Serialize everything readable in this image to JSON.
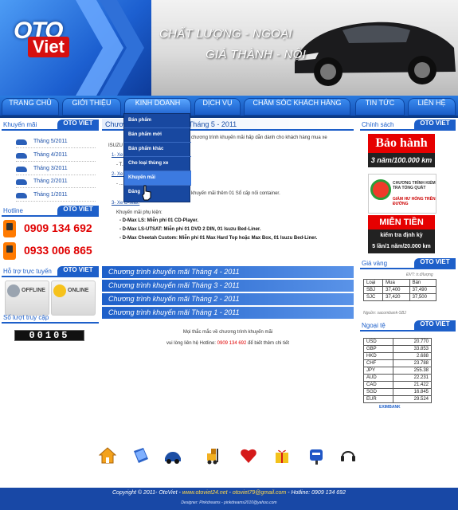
{
  "header": {
    "logo_oto": "OTO",
    "logo_viet": "Viet",
    "slogan_line1": "CHẤT LƯỢNG - NGOẠI",
    "slogan_line2": "GIÁ THÀNH - NỘI"
  },
  "nav": {
    "items": [
      "TRANG CHỦ",
      "GIỚI THIỆU",
      "KINH DOANH",
      "DỊCH VỤ",
      "CHĂM SÓC KHÁCH HÀNG",
      "TIN TỨC",
      "LIÊN HỆ"
    ],
    "active_index": 2
  },
  "dropdown": {
    "items": [
      "Bán phẩm",
      "Bán phẩm mới",
      "Bán phẩm khác",
      "Cho loại thùng xe",
      "Khuyến mãi",
      "Đăng"
    ],
    "hover_index": 4
  },
  "left": {
    "promo_title": "Khuyến mãi",
    "tag": "OTO VIET",
    "promo_items": [
      "Tháng 5/2011",
      "Tháng 4/2011",
      "Tháng 3/2011",
      "Tháng 2/2011",
      "Tháng 1/2011"
    ],
    "hotline_title": "Hotline",
    "hotline_numbers": [
      "0909 134 692",
      "0933 006 865"
    ],
    "support_title": "Hỗ trợ trực tuyến",
    "support_offline": "OFFLINE",
    "support_online": "ONLINE",
    "visits_title": "Số lượt truy cập",
    "visits_count": "00105"
  },
  "main": {
    "title": "Chương trình khuyến mãi Tháng 5 - 2011",
    "lines": [
      "chương trình khuyến mãi hấp dẫn dành cho khách hàng mua xe",
      "ISUZU tháng 5 năm 2011:",
      "1- Xe ...",
      "- T... layer",
      "2- Xe ...",
      "- ...",
      "khuyến mãi thêm 01 Sổ cấp nối container.",
      "3- Xe D-Max:",
      "Khuyến mãi phụ kiện:",
      "- D-Max LS: Miễn phí 01 CD-Player.",
      "- D-Max LS-UTSAT: Miễn phí 01 DVD 2 DIN, 01 Isuzu Bed-Liner.",
      "- D-Max Cheetah Custom: Miễn phí 01 Max Hard Top hoặc Max Box, 01 Isuzu Bed-Liner."
    ],
    "month_bars": [
      "Chương trình khuyến mãi Tháng 4 - 2011",
      "Chương trình khuyến mãi Tháng 3 - 2011",
      "Chương trình khuyến mãi Tháng 2 - 2011",
      "Chương trình khuyến mãi Tháng 1 - 2011"
    ],
    "note_line1": "Mọi thắc mắc về chương trình khuyến mãi",
    "note_line2_prefix": "vui lòng liên hệ Hotline: ",
    "note_hotline": "0909 134 692",
    "note_line2_suffix": " để biết thêm chi tiết"
  },
  "right": {
    "policy_title": "Chính sách",
    "tag": "OTO VIET",
    "warranty_top": "Bảo hành",
    "warranty_bottom": "3 năm/100.000 km",
    "check_line1": "CHƯƠNG TRÌNH KIỂM TRA TỔNG QUÁT",
    "check_line2": "GIẢM HƯ HỎNG TRÊN ĐƯỜNG",
    "free_title": "MIỄN TIỀN CÔNG",
    "free_sub1": "kiểm tra định kỳ",
    "free_sub2": "5 lần/1 năm/20.000 km",
    "gold_title": "Giá vàng",
    "gold_note": "ĐVT: tr.đ/lượng",
    "gold_headers": [
      "Loại",
      "Mua",
      "Bán"
    ],
    "gold_rows": [
      [
        "SBJ",
        "37,400",
        "37,490"
      ],
      [
        "SJC",
        "37,420",
        "37,500"
      ]
    ],
    "gold_source": "Nguồn: sacombank-SBJ",
    "fx_title": "Ngoại tệ",
    "fx_rows": [
      [
        "USD",
        "20.770"
      ],
      [
        "GBP",
        "33.853"
      ],
      [
        "HKD",
        "2.688"
      ],
      [
        "CHF",
        "23.788"
      ],
      [
        "JPY",
        "255.38"
      ],
      [
        "AUD",
        "22.231"
      ],
      [
        "CAD",
        "21.422"
      ],
      [
        "SGD",
        "16.845"
      ],
      [
        "EUR",
        "29.524"
      ]
    ],
    "fx_source": "EXIMBANK"
  },
  "footer_icons": [
    "home-icon",
    "book-icon",
    "car-icon",
    "forklift-icon",
    "heart-icon",
    "promotion-icon",
    "mailbox-icon",
    "support-headset-icon"
  ],
  "footer": {
    "copyright_prefix": "Copyright © 2011- OtoViet - ",
    "website": "www.otoviet24.net",
    "sep1": " - ",
    "email": "otoviet79@gmail.com",
    "hotline_text": " - Hotline: 0909 134 692",
    "designer": "Designer: Pinkdreams - pinkdreams2010@yahoo.com"
  },
  "colors": {
    "brand_blue": "#1d5fc9",
    "accent_red": "#e00000"
  }
}
